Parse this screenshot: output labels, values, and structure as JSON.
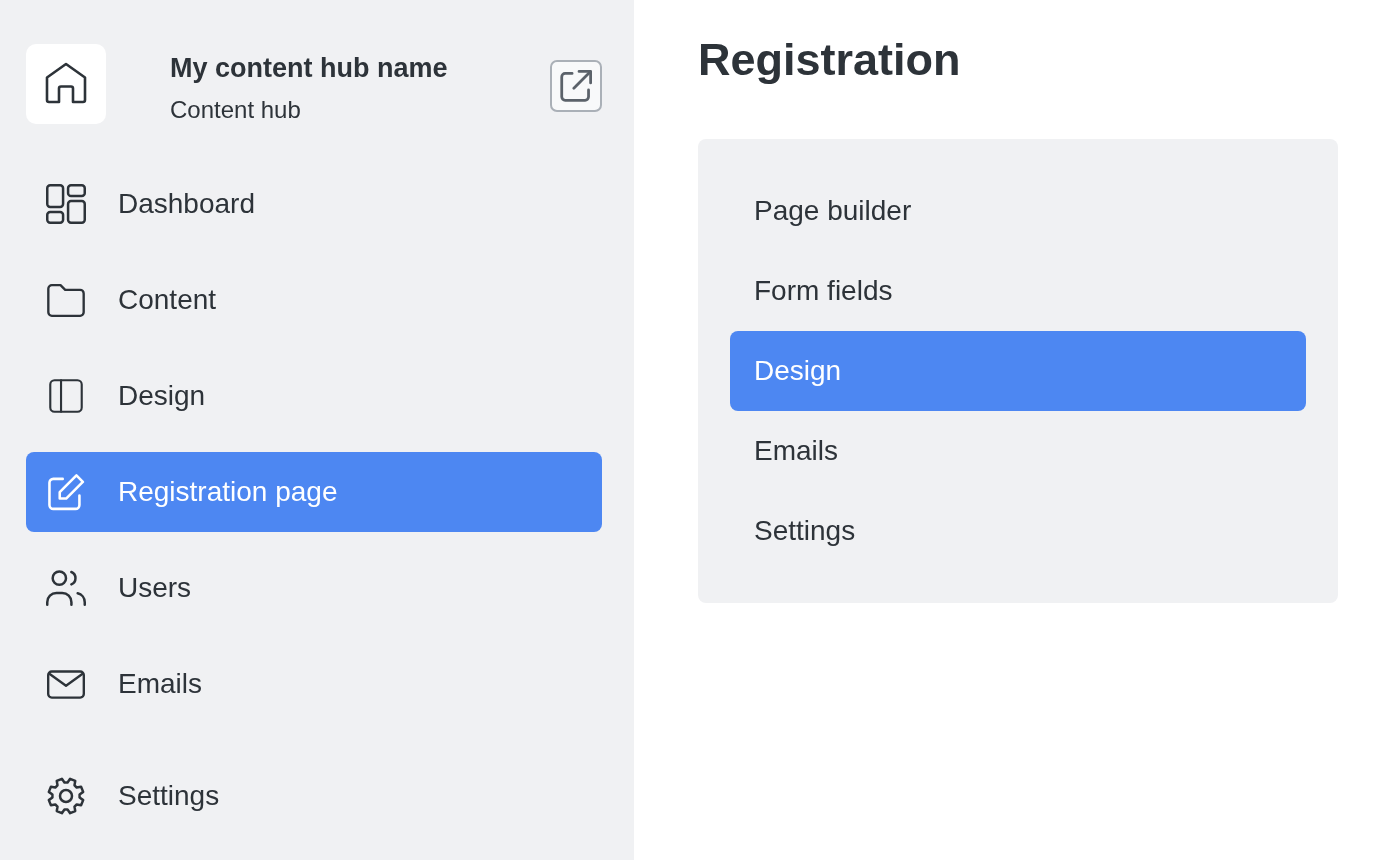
{
  "sidebar": {
    "hub": {
      "name": "My content hub name",
      "subtitle": "Content hub"
    },
    "items": [
      {
        "label": "Dashboard",
        "selected": false
      },
      {
        "label": "Content",
        "selected": false
      },
      {
        "label": "Design",
        "selected": false
      },
      {
        "label": "Registration page",
        "selected": true
      },
      {
        "label": "Users",
        "selected": false
      },
      {
        "label": "Emails",
        "selected": false
      }
    ],
    "footer_items": [
      {
        "label": "Settings",
        "selected": false
      }
    ]
  },
  "main": {
    "title": "Registration",
    "menu": [
      {
        "label": "Page builder",
        "selected": false
      },
      {
        "label": "Form fields",
        "selected": false
      },
      {
        "label": "Design",
        "selected": true
      },
      {
        "label": "Emails",
        "selected": false
      },
      {
        "label": "Settings",
        "selected": false
      }
    ]
  }
}
